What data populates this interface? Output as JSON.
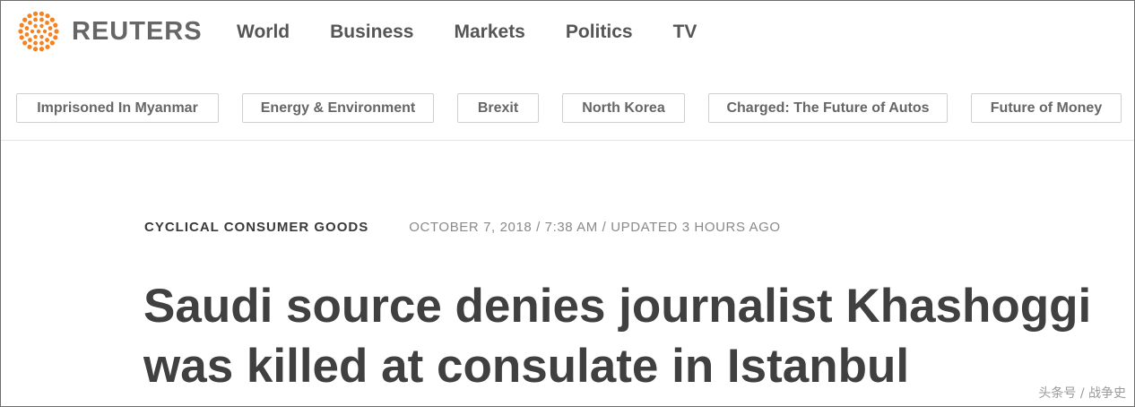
{
  "header": {
    "logo_text": "REUTERS",
    "logo_icon": "reuters-dot-logo",
    "brand_color": "#f58220",
    "nav": [
      "World",
      "Business",
      "Markets",
      "Politics",
      "TV"
    ]
  },
  "topics": [
    "Imprisoned In Myanmar",
    "Energy & Environment",
    "Brexit",
    "North Korea",
    "Charged: The Future of Autos",
    "Future of Money"
  ],
  "article": {
    "category": "CYCLICAL CONSUMER GOODS",
    "dateline": "OCTOBER 7, 2018 / 7:38 AM / UPDATED 3 HOURS AGO",
    "headline": "Saudi source denies journalist Khashoggi was killed at consulate in Istanbul"
  },
  "watermark": "头条号 / 战争史"
}
